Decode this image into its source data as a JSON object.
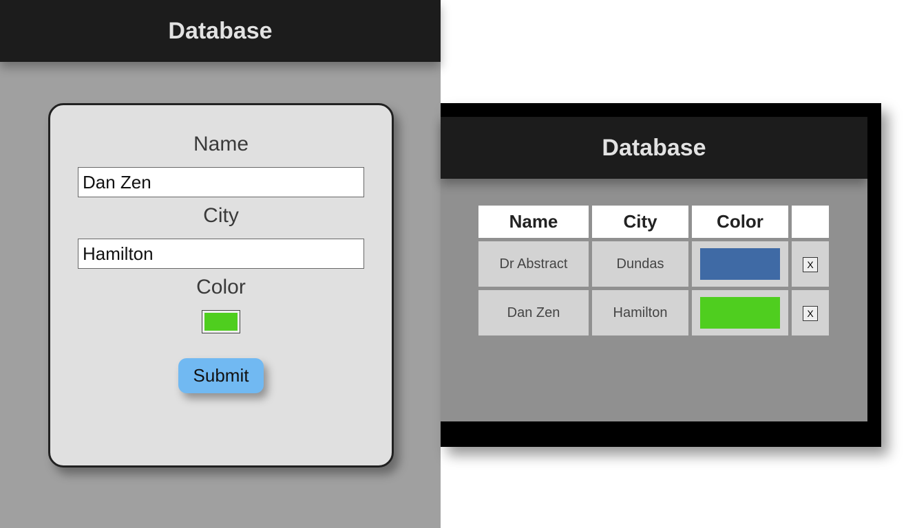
{
  "left": {
    "title": "Database",
    "form": {
      "name_label": "Name",
      "name_value": "Dan Zen",
      "city_label": "City",
      "city_value": "Hamilton",
      "color_label": "Color",
      "color_value": "#4fce1f",
      "submit_label": "Submit"
    }
  },
  "right": {
    "title": "Database",
    "columns": {
      "name": "Name",
      "city": "City",
      "color": "Color"
    },
    "delete_label": "X",
    "rows": [
      {
        "name": "Dr Abstract",
        "city": "Dundas",
        "color": "#3f6aa5"
      },
      {
        "name": "Dan Zen",
        "city": "Hamilton",
        "color": "#4fce1f"
      }
    ]
  }
}
